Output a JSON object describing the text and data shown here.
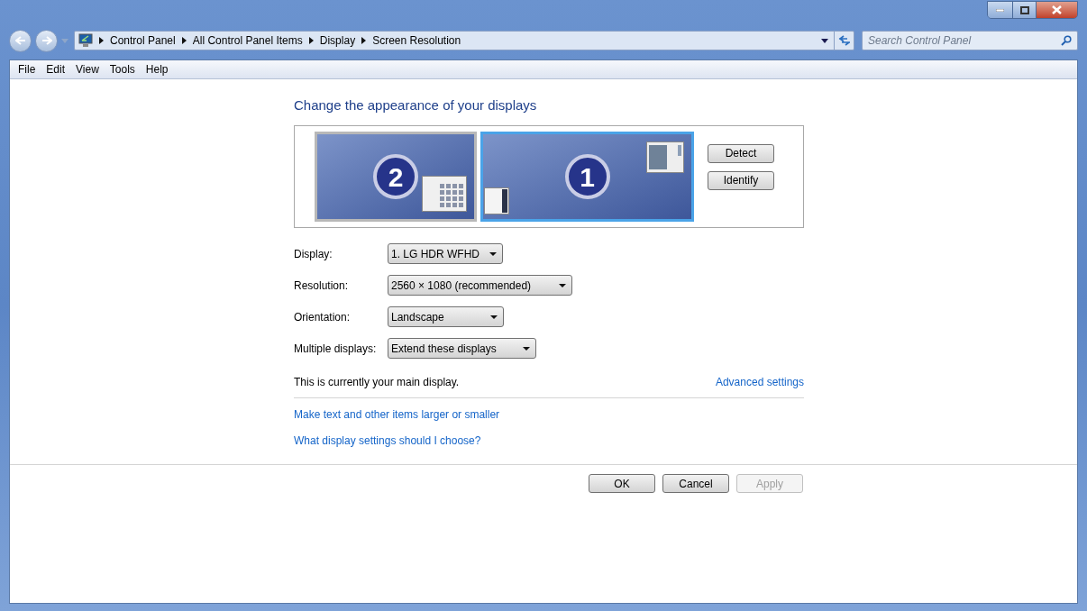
{
  "breadcrumb": [
    "Control Panel",
    "All Control Panel Items",
    "Display",
    "Screen Resolution"
  ],
  "search": {
    "placeholder": "Search Control Panel"
  },
  "menu": [
    "File",
    "Edit",
    "View",
    "Tools",
    "Help"
  ],
  "heading": "Change the appearance of your displays",
  "monitors": [
    {
      "number": "2",
      "selected": false
    },
    {
      "number": "1",
      "selected": true
    }
  ],
  "preview_buttons": [
    "Detect",
    "Identify"
  ],
  "settings": [
    {
      "label": "Display:",
      "value": "1. LG HDR WFHD"
    },
    {
      "label": "Resolution:",
      "value": "2560 × 1080 (recommended)"
    },
    {
      "label": "Orientation:",
      "value": "Landscape"
    },
    {
      "label": "Multiple displays:",
      "value": "Extend these displays"
    }
  ],
  "status": "This is currently your main display.",
  "advanced_link": "Advanced settings",
  "links": [
    "Make text and other items larger or smaller",
    "What display settings should I choose?"
  ],
  "buttons": [
    {
      "label": "OK",
      "disabled": false
    },
    {
      "label": "Cancel",
      "disabled": false
    },
    {
      "label": "Apply",
      "disabled": true
    }
  ]
}
